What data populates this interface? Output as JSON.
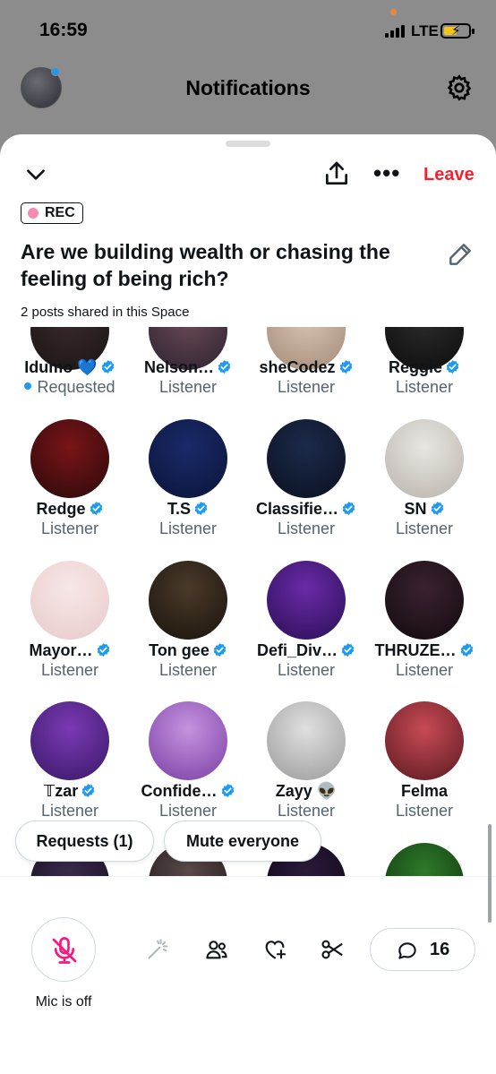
{
  "status_bar": {
    "time": "16:59",
    "network": "LTE"
  },
  "header": {
    "title": "Notifications"
  },
  "space": {
    "leave_label": "Leave",
    "rec_label": "REC",
    "title": "Are we building wealth or chasing the feeling of being rich?",
    "posts_shared": "2 posts shared in this Space"
  },
  "participants": [
    {
      "name": "Idumo 💙",
      "role": "Requested",
      "verified": true
    },
    {
      "name": "Nelson…",
      "role": "Listener",
      "verified": true
    },
    {
      "name": "sheCodez",
      "role": "Listener",
      "verified": true
    },
    {
      "name": "Reggie",
      "role": "Listener",
      "verified": true
    },
    {
      "name": "Redge",
      "role": "Listener",
      "verified": true
    },
    {
      "name": "T.S",
      "role": "Listener",
      "verified": true
    },
    {
      "name": "Classifie…",
      "role": "Listener",
      "verified": true
    },
    {
      "name": "SN",
      "role": "Listener",
      "verified": true
    },
    {
      "name": "Mayor…",
      "role": "Listener",
      "verified": true
    },
    {
      "name": "Ton gee",
      "role": "Listener",
      "verified": true
    },
    {
      "name": "Defi_Div…",
      "role": "Listener",
      "verified": true
    },
    {
      "name": "THRUZE…",
      "role": "Listener",
      "verified": true
    },
    {
      "name": "𝕋zar",
      "role": "Listener",
      "verified": true
    },
    {
      "name": "Confide…",
      "role": "Listener",
      "verified": true
    },
    {
      "name": "Zayy 👽",
      "role": "Listener",
      "verified": false
    },
    {
      "name": "Felma",
      "role": "Listener",
      "verified": false
    }
  ],
  "actions": {
    "requests_label": "Requests (1)",
    "mute_everyone_label": "Mute everyone"
  },
  "bottom": {
    "mic_label": "Mic is off",
    "comment_count": "16"
  },
  "icons": {
    "verified_color": "#1d9bf0",
    "leave_color": "#f4212e",
    "mic_off_color": "#f91880"
  }
}
